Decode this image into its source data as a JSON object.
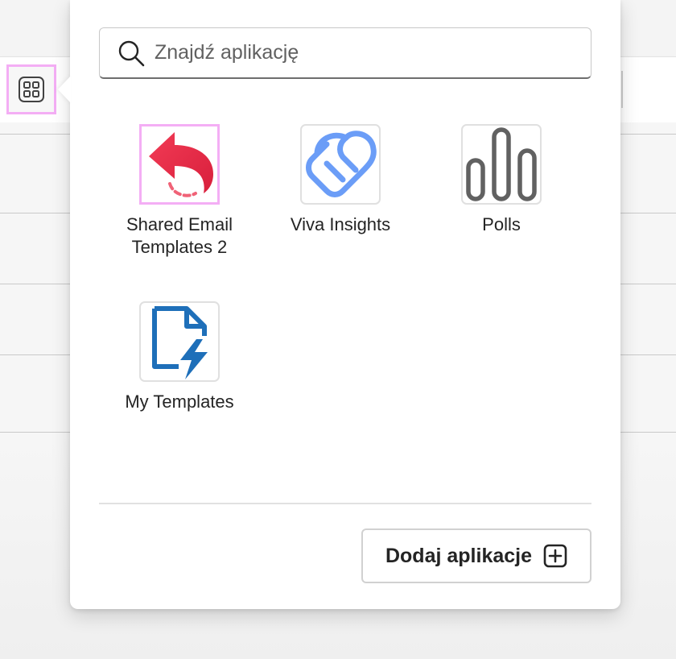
{
  "search": {
    "placeholder": "Znajdź aplikację"
  },
  "apps": [
    {
      "name": "Shared Email Templates 2",
      "label": "Shared Email\nTemplates 2",
      "icon": "red-reply-arrow-icon",
      "highlighted": true
    },
    {
      "name": "Viva Insights",
      "label": "Viva Insights",
      "icon": "viva-insights-icon",
      "highlighted": false
    },
    {
      "name": "Polls",
      "label": "Polls",
      "icon": "polls-bars-icon",
      "highlighted": false
    },
    {
      "name": "My Templates",
      "label": "My Templates",
      "icon": "document-lightning-icon",
      "highlighted": false
    }
  ],
  "footer": {
    "add_apps_label": "Dodaj aplikacje",
    "add_icon": "plus-square-icon"
  },
  "colors": {
    "highlight": "#f4aef5",
    "shared_templates_red": "#e8334a",
    "viva_blue": "#6b9df7",
    "polls_gray": "#616161",
    "my_templates_blue": "#1e6fb9"
  }
}
